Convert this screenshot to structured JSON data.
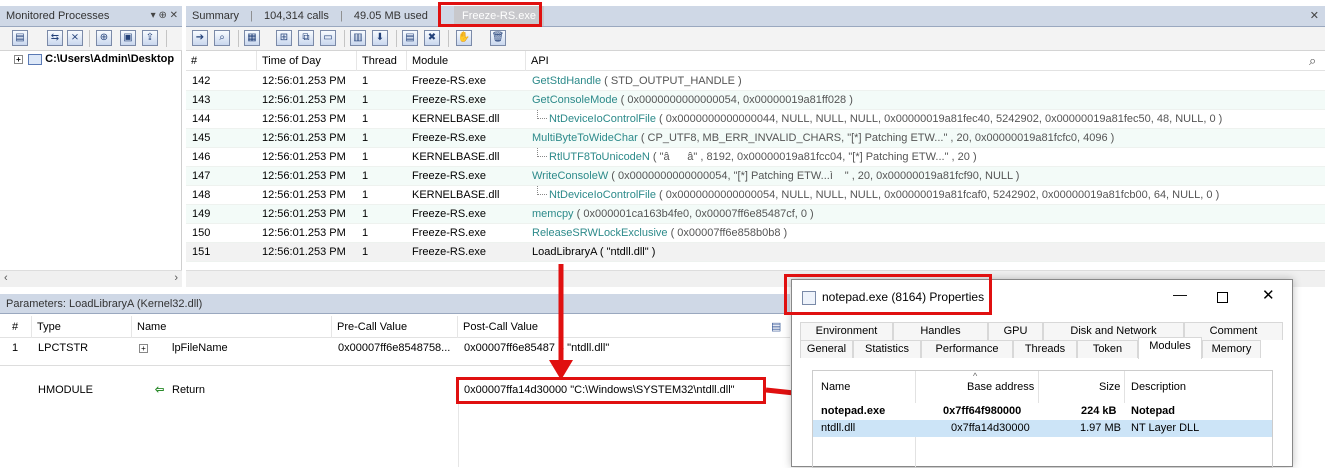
{
  "left_panel": {
    "title": "Monitored Processes",
    "pin_glyph": "▾ ⊕ ✕",
    "tree_item": "C:\\Users\\Admin\\Desktop"
  },
  "status_bar": {
    "summary": "Summary",
    "calls": "104,314 calls",
    "memory": "49.05 MB used",
    "process_tab": "Freeze-RS.exe"
  },
  "grid": {
    "headers": [
      "#",
      "Time of Day",
      "Thread",
      "Module",
      "API"
    ],
    "rows": [
      {
        "num": "142",
        "time": "12:56:01.253 PM",
        "thread": "1",
        "module": "Freeze-RS.exe",
        "fn": "GetStdHandle",
        "args": " ( STD_OUTPUT_HANDLE )",
        "indent": 0
      },
      {
        "num": "143",
        "time": "12:56:01.253 PM",
        "thread": "1",
        "module": "Freeze-RS.exe",
        "fn": "GetConsoleMode",
        "args": " ( 0x0000000000000054, 0x00000019a81ff028 )",
        "indent": 0
      },
      {
        "num": "144",
        "time": "12:56:01.253 PM",
        "thread": "1",
        "module": "KERNELBASE.dll",
        "fn": "NtDeviceIoControlFile",
        "args": " ( 0x0000000000000044, NULL, NULL, NULL, 0x00000019a81fec40, 5242902, 0x00000019a81fec50, 48, NULL, 0 )",
        "indent": 1
      },
      {
        "num": "145",
        "time": "12:56:01.253 PM",
        "thread": "1",
        "module": "Freeze-RS.exe",
        "fn": "MultiByteToWideChar",
        "args": " ( CP_UTF8, MB_ERR_INVALID_CHARS, \"[*] Patching ETW...\" , 20, 0x00000019a81fcfc0, 4096 )",
        "indent": 0
      },
      {
        "num": "146",
        "time": "12:56:01.253 PM",
        "thread": "1",
        "module": "KERNELBASE.dll",
        "fn": "RtlUTF8ToUnicodeN",
        "args": " ( \"ââ\" , 8192, 0x00000019a81fcc04, \"[*] Patching ETW...\" , 20 )",
        "indent": 1
      },
      {
        "num": "147",
        "time": "12:56:01.253 PM",
        "thread": "1",
        "module": "Freeze-RS.exe",
        "fn": "WriteConsoleW",
        "args": " ( 0x0000000000000054, \"[*] Patching ETW...ì \" , 20, 0x00000019a81fcf90, NULL )",
        "indent": 0
      },
      {
        "num": "148",
        "time": "12:56:01.253 PM",
        "thread": "1",
        "module": "KERNELBASE.dll",
        "fn": "NtDeviceIoControlFile",
        "args": " ( 0x0000000000000054, NULL, NULL, NULL, 0x00000019a81fcaf0, 5242902, 0x00000019a81fcb00, 64, NULL, 0 )",
        "indent": 1
      },
      {
        "num": "149",
        "time": "12:56:01.253 PM",
        "thread": "1",
        "module": "Freeze-RS.exe",
        "fn": "memcpy",
        "args": " ( 0x000001ca163b4fe0, 0x00007ff6e85487cf, 0 )",
        "indent": 0
      },
      {
        "num": "150",
        "time": "12:56:01.253 PM",
        "thread": "1",
        "module": "Freeze-RS.exe",
        "fn": "ReleaseSRWLockExclusive",
        "args": " ( 0x00007ff6e858b0b8 )",
        "indent": 0
      },
      {
        "num": "151",
        "time": "12:56:01.253 PM",
        "thread": "1",
        "module": "Freeze-RS.exe",
        "fn": "LoadLibraryA",
        "args": " ( \"ntdll.dll\" )",
        "indent": 0,
        "selected": true
      }
    ]
  },
  "params": {
    "title": "Parameters: LoadLibraryA (Kernel32.dll)",
    "headers": [
      "#",
      "Type",
      "Name",
      "Pre-Call Value",
      "Post-Call Value"
    ],
    "row": {
      "num": "1",
      "type": "LPCTSTR",
      "name": "lpFileName",
      "pre": "0x00007ff6e8548758...",
      "post": "0x00007ff6e85487 8 \"ntdll.dll\""
    },
    "ret": {
      "type": "HMODULE",
      "name": "Return",
      "value": "0x00007ffa14d30000 \"C:\\Windows\\SYSTEM32\\ntdll.dll\""
    }
  },
  "dialog": {
    "title": "notepad.exe (8164) Properties",
    "tabs_top": [
      "Environment",
      "Handles",
      "GPU",
      "Disk and Network",
      "Comment"
    ],
    "tabs_bottom": [
      "General",
      "Statistics",
      "Performance",
      "Threads",
      "Token",
      "Modules",
      "Memory"
    ],
    "active_tab": "Modules",
    "headers": [
      "Name",
      "Base address",
      "Size",
      "Description"
    ],
    "modules": [
      {
        "name": "notepad.exe",
        "base": "0x7ff64f980000",
        "size": "224 kB",
        "desc": "Notepad"
      },
      {
        "name": "ntdll.dll",
        "base": "0x7ffa14d30000",
        "size": "1.97 MB",
        "desc": "NT Layer DLL"
      }
    ]
  },
  "colors": {
    "highlight": "#e01010",
    "row_alt": "#f0faf6",
    "api_text": "#2c8a8a"
  }
}
